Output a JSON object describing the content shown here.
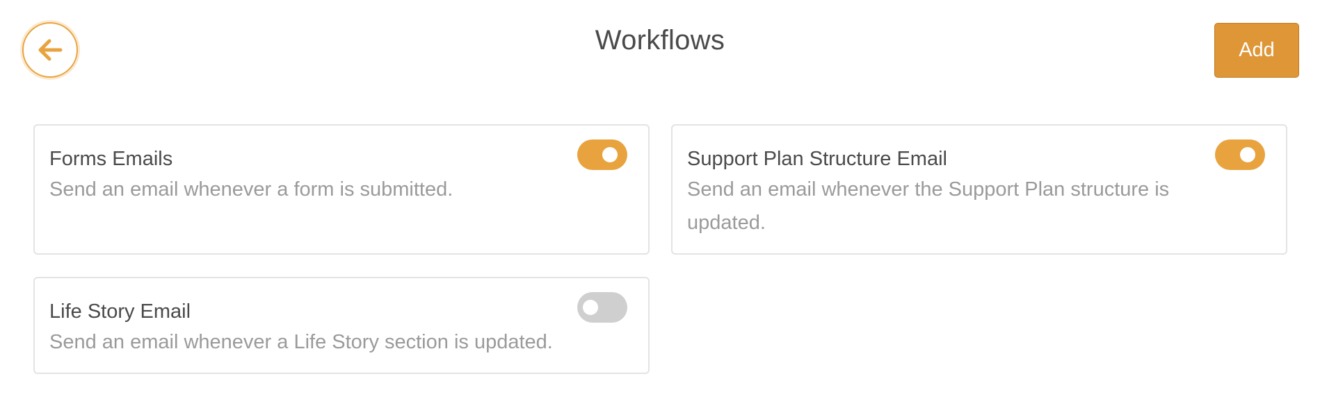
{
  "header": {
    "back_icon": "arrow-left-icon",
    "title": "Workflows",
    "add_label": "Add"
  },
  "colors": {
    "accent": "#e8a33e",
    "add_button": "#de9637",
    "toggle_off": "#cfcfcf",
    "title_text": "#4a4a4a",
    "description_text": "#9a9a9a"
  },
  "workflows": [
    {
      "title": "Forms Emails",
      "description": "Send an email whenever a form is submitted.",
      "enabled": true
    },
    {
      "title": "Support Plan Structure Email",
      "description": "Send an email whenever the Support Plan structure is updated.",
      "enabled": true
    },
    {
      "title": "Life Story Email",
      "description": "Send an email whenever a Life Story section is updated.",
      "enabled": false
    }
  ]
}
